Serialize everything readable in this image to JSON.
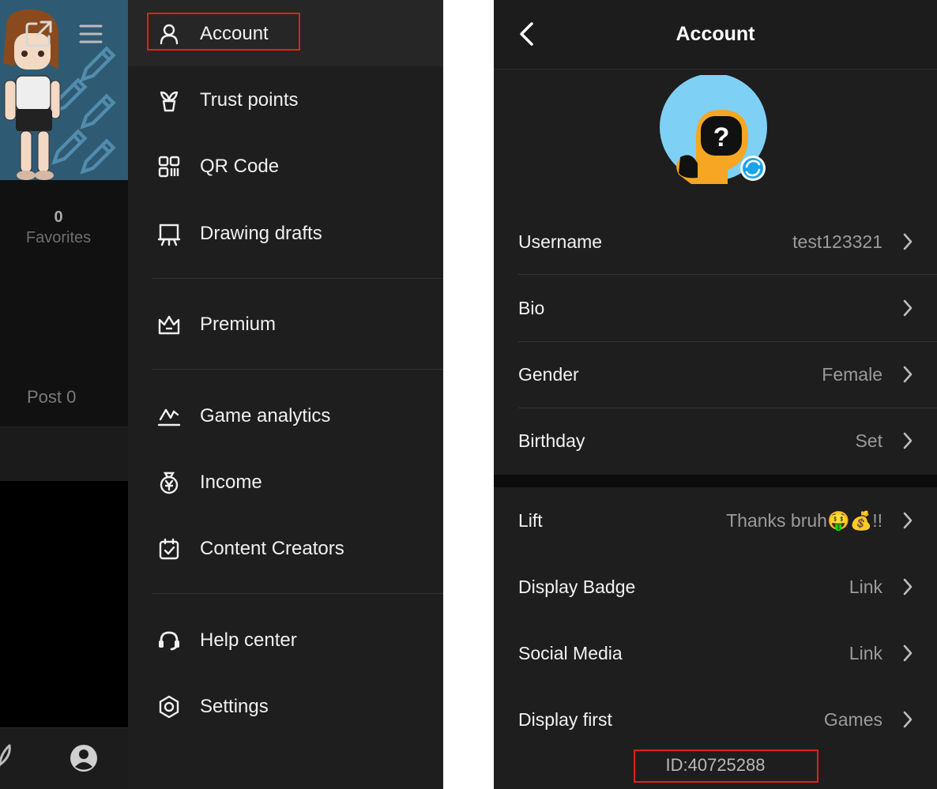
{
  "left": {
    "profile": {
      "favorites_count": "0",
      "favorites_label": "Favorites",
      "post_label": "Post 0"
    },
    "menu": {
      "items": [
        {
          "id": "account",
          "label": "Account",
          "icon": "person-icon"
        },
        {
          "id": "trust-points",
          "label": "Trust points",
          "icon": "sprout-icon"
        },
        {
          "id": "qr-code",
          "label": "QR Code",
          "icon": "qr-code-icon"
        },
        {
          "id": "drawing-drafts",
          "label": "Drawing drafts",
          "icon": "easel-icon"
        },
        {
          "id": "premium",
          "label": "Premium",
          "icon": "crown-icon"
        },
        {
          "id": "game-analytics",
          "label": "Game analytics",
          "icon": "analytics-icon"
        },
        {
          "id": "income",
          "label": "Income",
          "icon": "money-bag-icon"
        },
        {
          "id": "content-creators",
          "label": "Content Creators",
          "icon": "calendar-check-icon"
        },
        {
          "id": "help-center",
          "label": "Help center",
          "icon": "headset-icon"
        },
        {
          "id": "settings",
          "label": "Settings",
          "icon": "gear-icon"
        }
      ]
    }
  },
  "right": {
    "header": {
      "title": "Account"
    },
    "rows": [
      {
        "label": "Username",
        "value": "test123321"
      },
      {
        "label": "Bio",
        "value": ""
      },
      {
        "label": "Gender",
        "value": "Female"
      },
      {
        "label": "Birthday",
        "value": "Set"
      },
      {
        "label": "Lift",
        "value": "Thanks bruh🤑💰!!"
      },
      {
        "label": "Display Badge",
        "value": "Link"
      },
      {
        "label": "Social Media",
        "value": "Link"
      },
      {
        "label": "Display first",
        "value": "Games"
      }
    ],
    "user_id": "ID:40725288"
  },
  "colors": {
    "highlight_box": "#e0201b",
    "drawer_bg": "#1e1e1e",
    "avatar_ring": "#7fd0f5",
    "avatar_face": "#f6a623",
    "refresh_badge": "#1aa3e8"
  }
}
